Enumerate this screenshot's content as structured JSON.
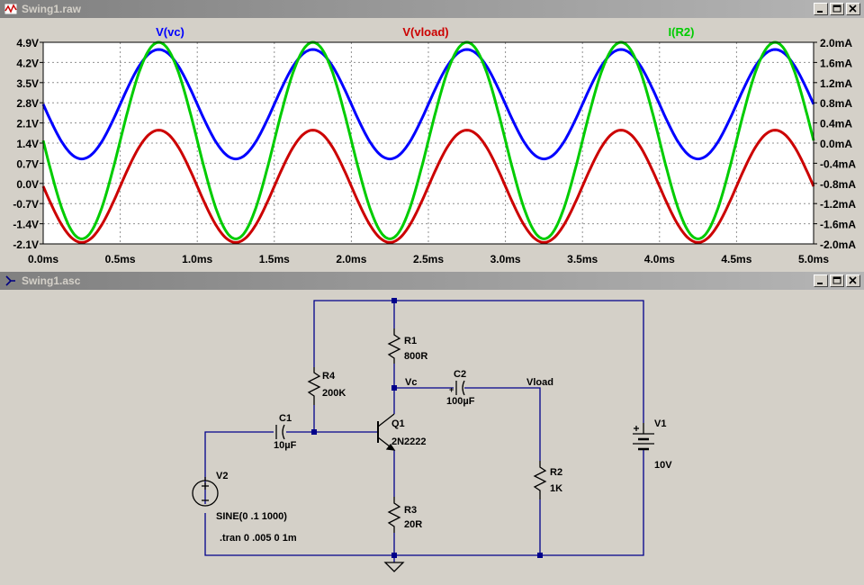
{
  "plot_window": {
    "title": "Swing1.raw",
    "trace_labels": [
      {
        "name": "V(vc)",
        "color": "#0000ff"
      },
      {
        "name": "V(vload)",
        "color": "#cc0000"
      },
      {
        "name": "I(R2)",
        "color": "#00cc00"
      }
    ]
  },
  "schematic_window": {
    "title": "Swing1.asc",
    "labels": {
      "r1_name": "R1",
      "r1_val": "800R",
      "r2_name": "R2",
      "r2_val": "1K",
      "r3_name": "R3",
      "r3_val": "20R",
      "r4_name": "R4",
      "r4_val": "200K",
      "c1_name": "C1",
      "c1_val": "10µF",
      "c2_name": "C2",
      "c2_val": "100µF",
      "q1_name": "Q1",
      "q1_val": "2N2222",
      "v1_name": "V1",
      "v1_val": "10V",
      "v2_name": "V2",
      "v2_val": "SINE(0 .1 1000)",
      "net_vc": "Vc",
      "net_vload": "Vload",
      "directive": ".tran 0 .005 0 1m"
    }
  },
  "chart_data": {
    "type": "line",
    "x_ticks": [
      "0.0ms",
      "0.5ms",
      "1.0ms",
      "1.5ms",
      "2.0ms",
      "2.5ms",
      "3.0ms",
      "3.5ms",
      "4.0ms",
      "4.5ms",
      "5.0ms"
    ],
    "y_left_ticks": [
      "4.9V",
      "4.2V",
      "3.5V",
      "2.8V",
      "2.1V",
      "1.4V",
      "0.7V",
      "0.0V",
      "-0.7V",
      "-1.4V",
      "-2.1V"
    ],
    "y_right_ticks": [
      "2.0mA",
      "1.6mA",
      "1.2mA",
      "0.8mA",
      "0.4mA",
      "0.0mA",
      "-0.4mA",
      "-0.8mA",
      "-1.2mA",
      "-1.6mA",
      "-2.0mA"
    ],
    "xlim": [
      0,
      5
    ],
    "ylim_left": [
      -2.1,
      4.9
    ],
    "ylim_right": [
      -2.0,
      2.0
    ],
    "grid": true,
    "series": [
      {
        "name": "V(vc)",
        "color": "#0000ff",
        "axis": "left",
        "offset": 2.75,
        "amplitude": 1.9,
        "phase_ms": 0.75,
        "freq_khz": 1
      },
      {
        "name": "V(vload)",
        "color": "#cc0000",
        "axis": "left",
        "offset": -0.1,
        "amplitude": 1.95,
        "phase_ms": 0.75,
        "freq_khz": 1
      },
      {
        "name": "I(R2)",
        "color": "#00cc00",
        "axis": "right",
        "offset": 0.05,
        "amplitude": 1.95,
        "phase_ms": 0.75,
        "freq_khz": 1
      }
    ]
  }
}
